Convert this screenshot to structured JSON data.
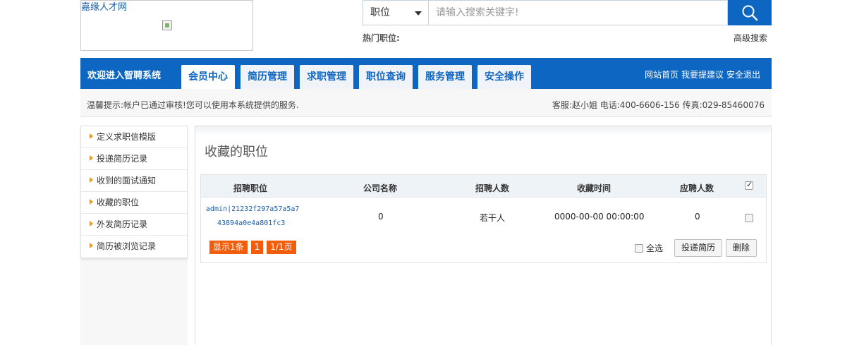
{
  "header": {
    "logo_text": "嘉缘人才网",
    "search_select": "职位",
    "search_placeholder": "请输入搜索关键字!",
    "hot_label": "热门职位:",
    "advanced_search": "高级搜索"
  },
  "nav": {
    "welcome": "欢迎进入智聘系统",
    "tabs": [
      "会员中心",
      "简历管理",
      "求职管理",
      "职位查询",
      "服务管理",
      "安全操作"
    ],
    "active_tab": 0,
    "links": [
      "网站首页",
      "我要提建议",
      "安全退出"
    ]
  },
  "notice": {
    "tip": "温馨提示:帐户已通过审核!您可以使用本系统提供的服务.",
    "contact": "客服:赵小姐 电话:400-6606-156 传真:029-85460076"
  },
  "sidebar": {
    "items": [
      "定义求职信模版",
      "投递简历记录",
      "收到的面试通知",
      "收藏的职位",
      "外发简历记录",
      "简历被浏览记录"
    ]
  },
  "main": {
    "title": "收藏的职位",
    "columns": [
      "招聘职位",
      "公司名称",
      "招聘人数",
      "收藏时间",
      "应聘人数"
    ],
    "rows": [
      {
        "job_line1": "admin|21232f297a57a5a7",
        "job_line2": "43894a0e4a801fc3",
        "company": "0",
        "headcount": "若干人",
        "saved_time": "0000-00-00 00:00:00",
        "applicants": "0"
      }
    ],
    "pager": [
      "显示1条",
      "1",
      "1/1页"
    ],
    "select_all": "全选",
    "deliver_button": "投递简历",
    "delete_button": "删除"
  },
  "colors": {
    "brand_blue": "#0e66c3",
    "pager_orange": "#f25d0b",
    "arrow_orange": "#f39800"
  }
}
